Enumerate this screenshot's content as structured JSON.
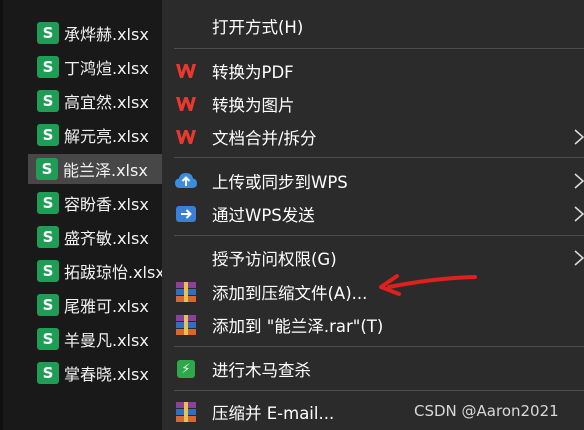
{
  "files": [
    {
      "name": "承烨赫.xlsx"
    },
    {
      "name": "丁鸿煊.xlsx"
    },
    {
      "name": "高宜然.xlsx"
    },
    {
      "name": "解元亮.xlsx"
    },
    {
      "name": "能兰泽.xlsx",
      "selected": true
    },
    {
      "name": "容盼香.xlsx"
    },
    {
      "name": "盛齐敏.xlsx"
    },
    {
      "name": "拓跋琼怡.xlsx"
    },
    {
      "name": "尾雅可.xlsx"
    },
    {
      "name": "羊曼凡.xlsx"
    },
    {
      "name": "掌春晓.xlsx"
    }
  ],
  "file_icon_letter": "S",
  "menu": {
    "open_with": "打开方式(H)",
    "convert_pdf": "转换为PDF",
    "convert_image": "转换为图片",
    "merge_split": "文档合并/拆分",
    "upload_wps": "上传或同步到WPS",
    "send_wps": "通过WPS发送",
    "grant_access": "授予访问权限(G)",
    "add_archive": "添加到压缩文件(A)...",
    "add_rar": "添加到 \"能兰泽.rar\"(T)",
    "virus_scan": "进行木马查杀",
    "compress_email": "压缩并 E-mail..."
  },
  "watermark": "CSDN @Aaron2021",
  "colors": {
    "menu_bg": "#2b2b2b",
    "wps_red": "#e8392f",
    "excel_green": "#1f9d57",
    "annotation_red": "#e0201c"
  },
  "icons": {
    "wps": "wps-logo-icon",
    "upload": "cloud-upload-icon",
    "send": "send-arrow-icon",
    "archive": "winrar-icon",
    "scan": "shield-icon"
  }
}
